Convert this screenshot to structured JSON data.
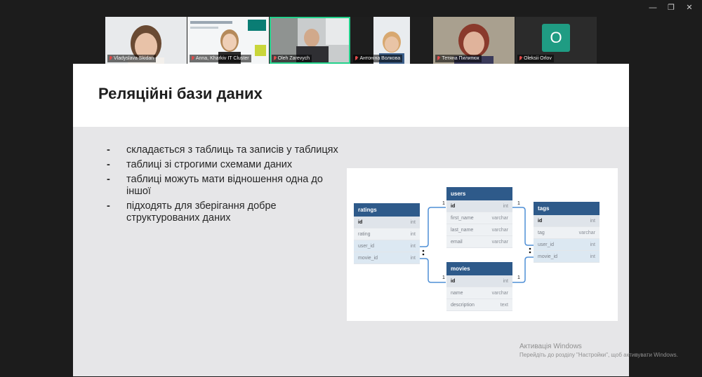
{
  "window": {
    "minimize": "—",
    "restore": "❐",
    "close": "✕"
  },
  "participants": [
    {
      "name": "Vladyslava Skidan",
      "muted": true
    },
    {
      "name": "Anna, Kharkiv IT Cluster",
      "muted": true
    },
    {
      "name": "Oleh Zarevych",
      "muted": true,
      "active": true
    },
    {
      "name": "Антоніна Волкова",
      "muted": true
    },
    {
      "name": "Тетяна Пилипюк",
      "muted": true
    },
    {
      "name": "Oleksii Orlov",
      "muted": true,
      "initial": "O"
    }
  ],
  "slide": {
    "title": "Реляційні бази даних",
    "bullets": [
      "складається з таблиць та записів у таблицях",
      "таблиці зі строгими схемами даних",
      "таблиці можуть мати відношення одна до іншої",
      "підходять для зберігання добре структурованих даних"
    ],
    "bullet_marker": "-"
  },
  "diagram": {
    "tables": [
      {
        "name": "ratings",
        "rows": [
          {
            "field": "id",
            "type": "int",
            "kind": "pk"
          },
          {
            "field": "rating",
            "type": "int",
            "kind": ""
          },
          {
            "field": "user_id",
            "type": "int",
            "kind": "fk"
          },
          {
            "field": "movie_id",
            "type": "int",
            "kind": "fk"
          }
        ]
      },
      {
        "name": "users",
        "rows": [
          {
            "field": "id",
            "type": "int",
            "kind": "pk"
          },
          {
            "field": "first_name",
            "type": "varchar",
            "kind": ""
          },
          {
            "field": "last_name",
            "type": "varchar",
            "kind": ""
          },
          {
            "field": "email",
            "type": "varchar",
            "kind": ""
          }
        ]
      },
      {
        "name": "movies",
        "rows": [
          {
            "field": "id",
            "type": "int",
            "kind": "pk"
          },
          {
            "field": "name",
            "type": "varchar",
            "kind": ""
          },
          {
            "field": "description",
            "type": "text",
            "kind": ""
          }
        ]
      },
      {
        "name": "tags",
        "rows": [
          {
            "field": "id",
            "type": "int",
            "kind": "pk"
          },
          {
            "field": "tag",
            "type": "varchar",
            "kind": ""
          },
          {
            "field": "user_id",
            "type": "int",
            "kind": "fk"
          },
          {
            "field": "movie_id",
            "type": "int",
            "kind": "fk"
          }
        ]
      }
    ],
    "cardinality_one": "1"
  },
  "watermark": {
    "title": "Активація Windows",
    "subtitle": "Перейдіть до розділу \"Настройки\", щоб активувати Windows."
  },
  "colors": {
    "table_header": "#2e5a8a",
    "active_speaker": "#23d18b",
    "avatar": "#1f9c83",
    "connector": "#4f8fd6"
  }
}
